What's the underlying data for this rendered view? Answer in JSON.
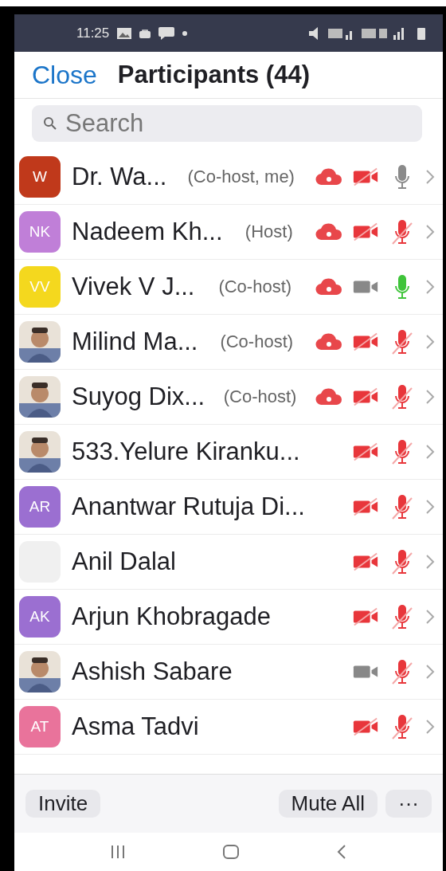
{
  "status_bar": {
    "time": "11:25"
  },
  "header": {
    "close": "Close",
    "title": "Participants (44)"
  },
  "search": {
    "placeholder": "Search"
  },
  "participants": [
    {
      "name": "Dr. Wa...",
      "role": "(Co-host, me)",
      "avatar": {
        "kind": "initials",
        "text": "W",
        "color": "#c0391b"
      },
      "recording": true,
      "video_off": true,
      "muted": false,
      "speaking": false
    },
    {
      "name": "Nadeem Kh...",
      "role": "(Host)",
      "avatar": {
        "kind": "initials",
        "text": "NK",
        "color": "#c07fd8"
      },
      "recording": true,
      "video_off": true,
      "muted": true,
      "speaking": false
    },
    {
      "name": "Vivek V J...",
      "role": "(Co-host)",
      "avatar": {
        "kind": "initials",
        "text": "VV",
        "color": "#f4d81e"
      },
      "recording": true,
      "video_off": false,
      "muted": false,
      "speaking": true
    },
    {
      "name": "Milind Ma...",
      "role": "(Co-host)",
      "recording": true,
      "video_off": true,
      "muted": true,
      "speaking": false
    },
    {
      "name": "Suyog Dix...",
      "role": "(Co-host)",
      "recording": true,
      "video_off": true,
      "muted": true,
      "speaking": false
    },
    {
      "name": "533.Yelure Kiranku...",
      "recording": false,
      "video_off": true,
      "muted": true,
      "speaking": false
    },
    {
      "name": "Anantwar Rutuja Di...",
      "avatar": {
        "kind": "initials",
        "text": "AR",
        "color": "#9b6fd1"
      },
      "recording": false,
      "video_off": true,
      "muted": true,
      "speaking": false
    },
    {
      "name": "Anil Dalal",
      "avatar": {
        "kind": "blank"
      },
      "recording": false,
      "video_off": true,
      "muted": true,
      "speaking": false
    },
    {
      "name": "Arjun Khobragade",
      "avatar": {
        "kind": "initials",
        "text": "AK",
        "color": "#9b6fd1"
      },
      "recording": false,
      "video_off": true,
      "muted": true,
      "speaking": false
    },
    {
      "name": "Ashish Sabare",
      "recording": false,
      "video_off": false,
      "muted": true,
      "speaking": false
    },
    {
      "name": "Asma Tadvi",
      "avatar": {
        "kind": "initials",
        "text": "AT",
        "color": "#e9739b"
      },
      "recording": false,
      "video_off": true,
      "muted": true,
      "speaking": false
    }
  ],
  "footer": {
    "invite": "Invite",
    "mute_all": "Mute All",
    "more": "···"
  }
}
